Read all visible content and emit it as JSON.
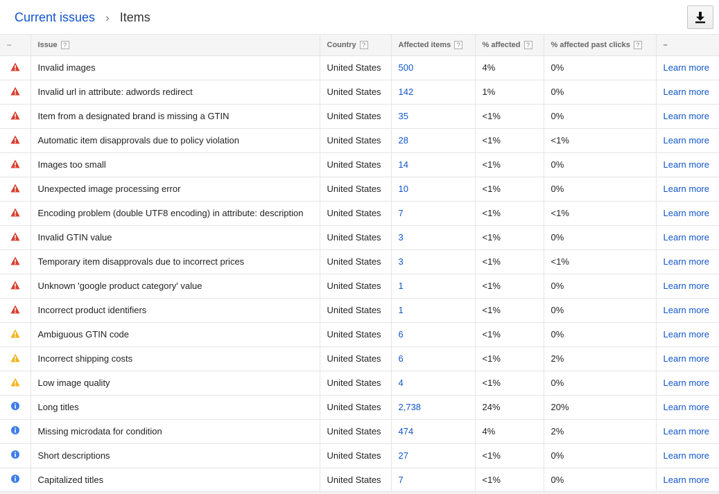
{
  "breadcrumb": {
    "parent": "Current issues",
    "separator": "›",
    "current": "Items"
  },
  "toolbar": {
    "download_icon": "download-icon"
  },
  "colors": {
    "error": "#d93f2f",
    "warning": "#f2b51c",
    "info": "#3e7ee8",
    "link": "#1155cc"
  },
  "table": {
    "headers": {
      "status": "–",
      "issue": "Issue",
      "country": "Country",
      "affected": "Affected items",
      "pct_affected": "% affected",
      "pct_clicks": "% affected past clicks",
      "action": "–"
    },
    "help_glyph": "?",
    "rows": [
      {
        "severity": "error",
        "issue": "Invalid images",
        "country": "United States",
        "affected": "500",
        "pct": "4%",
        "clicks": "0%",
        "action": "Learn more"
      },
      {
        "severity": "error",
        "issue": "Invalid url in attribute: adwords redirect",
        "country": "United States",
        "affected": "142",
        "pct": "1%",
        "clicks": "0%",
        "action": "Learn more"
      },
      {
        "severity": "error",
        "issue": "Item from a designated brand is missing a GTIN",
        "country": "United States",
        "affected": "35",
        "pct": "<1%",
        "clicks": "0%",
        "action": "Learn more"
      },
      {
        "severity": "error",
        "issue": "Automatic item disapprovals due to policy violation",
        "country": "United States",
        "affected": "28",
        "pct": "<1%",
        "clicks": "<1%",
        "action": "Learn more"
      },
      {
        "severity": "error",
        "issue": "Images too small",
        "country": "United States",
        "affected": "14",
        "pct": "<1%",
        "clicks": "0%",
        "action": "Learn more"
      },
      {
        "severity": "error",
        "issue": "Unexpected image processing error",
        "country": "United States",
        "affected": "10",
        "pct": "<1%",
        "clicks": "0%",
        "action": "Learn more"
      },
      {
        "severity": "error",
        "issue": "Encoding problem (double UTF8 encoding) in attribute: description",
        "country": "United States",
        "affected": "7",
        "pct": "<1%",
        "clicks": "<1%",
        "action": "Learn more"
      },
      {
        "severity": "error",
        "issue": "Invalid GTIN value",
        "country": "United States",
        "affected": "3",
        "pct": "<1%",
        "clicks": "0%",
        "action": "Learn more"
      },
      {
        "severity": "error",
        "issue": "Temporary item disapprovals due to incorrect prices",
        "country": "United States",
        "affected": "3",
        "pct": "<1%",
        "clicks": "<1%",
        "action": "Learn more"
      },
      {
        "severity": "error",
        "issue": "Unknown 'google product category' value",
        "country": "United States",
        "affected": "1",
        "pct": "<1%",
        "clicks": "0%",
        "action": "Learn more"
      },
      {
        "severity": "error",
        "issue": "Incorrect product identifiers",
        "country": "United States",
        "affected": "1",
        "pct": "<1%",
        "clicks": "0%",
        "action": "Learn more"
      },
      {
        "severity": "warning",
        "issue": "Ambiguous GTIN code",
        "country": "United States",
        "affected": "6",
        "pct": "<1%",
        "clicks": "0%",
        "action": "Learn more"
      },
      {
        "severity": "warning",
        "issue": "Incorrect shipping costs",
        "country": "United States",
        "affected": "6",
        "pct": "<1%",
        "clicks": "2%",
        "action": "Learn more"
      },
      {
        "severity": "warning",
        "issue": "Low image quality",
        "country": "United States",
        "affected": "4",
        "pct": "<1%",
        "clicks": "0%",
        "action": "Learn more"
      },
      {
        "severity": "info",
        "issue": "Long titles",
        "country": "United States",
        "affected": "2,738",
        "pct": "24%",
        "clicks": "20%",
        "action": "Learn more"
      },
      {
        "severity": "info",
        "issue": "Missing microdata for condition",
        "country": "United States",
        "affected": "474",
        "pct": "4%",
        "clicks": "2%",
        "action": "Learn more"
      },
      {
        "severity": "info",
        "issue": "Short descriptions",
        "country": "United States",
        "affected": "27",
        "pct": "<1%",
        "clicks": "0%",
        "action": "Learn more"
      },
      {
        "severity": "info",
        "issue": "Capitalized titles",
        "country": "United States",
        "affected": "7",
        "pct": "<1%",
        "clicks": "0%",
        "action": "Learn more"
      }
    ]
  }
}
